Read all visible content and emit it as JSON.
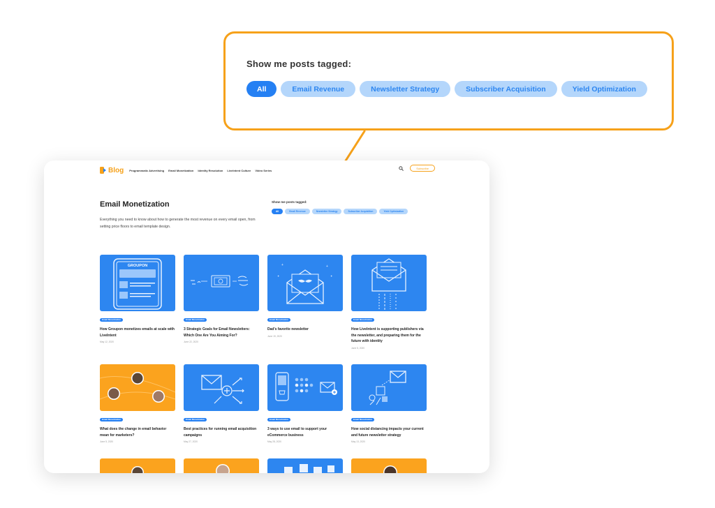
{
  "callout": {
    "title": "Show me posts tagged:",
    "tags": [
      "All",
      "Email Revenue",
      "Newsletter Strategy",
      "Subscriber Acquisition",
      "Yield Optimization"
    ]
  },
  "nav": {
    "logo": "Blog",
    "links": [
      "Programmatic Advertising",
      "Email Monetization",
      "Identity Resolution",
      "LiveIntent Culture",
      "Video Series"
    ],
    "subscribe": "Subscribe"
  },
  "page": {
    "title": "Email Monetization",
    "description": "Everything you need to know about how to generate the most revenue on every email open, from setting price floors to email template design.",
    "tags_title": "Show me posts tagged:"
  },
  "posts": [
    {
      "badge": "Email Monetization",
      "title": "How Groupon monetizes emails at scale with LiveIntent",
      "date": "May 12, 2020"
    },
    {
      "badge": "Email Monetization",
      "title": "3 Strategic Goals for Email Newsletters: Which One Are You Aiming For?",
      "date": "June 22, 2020"
    },
    {
      "badge": "Email Monetization",
      "title": "Dad's favorite newsletter",
      "date": "June 19, 2020"
    },
    {
      "badge": "Email Monetization",
      "title": "How LiveIntent is supporting publishers via the newsletter, and preparing them for the future with identity",
      "date": "June 5, 2020"
    },
    {
      "badge": "Email Monetization",
      "title": "What does the change in email behavior mean for marketers?",
      "date": "June 5, 2020"
    },
    {
      "badge": "Email Monetization",
      "title": "Best practices for running email acquisition campaigns",
      "date": "May 27, 2020"
    },
    {
      "badge": "Email Monetization",
      "title": "3 ways to use email to support your eCommerce business",
      "date": "May 28, 2020"
    },
    {
      "badge": "Email Monetization",
      "title": "How social distancing impacts your current and future newsletter strategy",
      "date": "May 13, 2020"
    }
  ],
  "thumb_labels": {
    "groupon": "GROUPON"
  },
  "colors": {
    "accent": "#f6a11a",
    "blue": "#2580f3",
    "light_blue": "#b4d6fb",
    "thumb_blue": "#2d86f0",
    "thumb_orange": "#fba31e"
  }
}
